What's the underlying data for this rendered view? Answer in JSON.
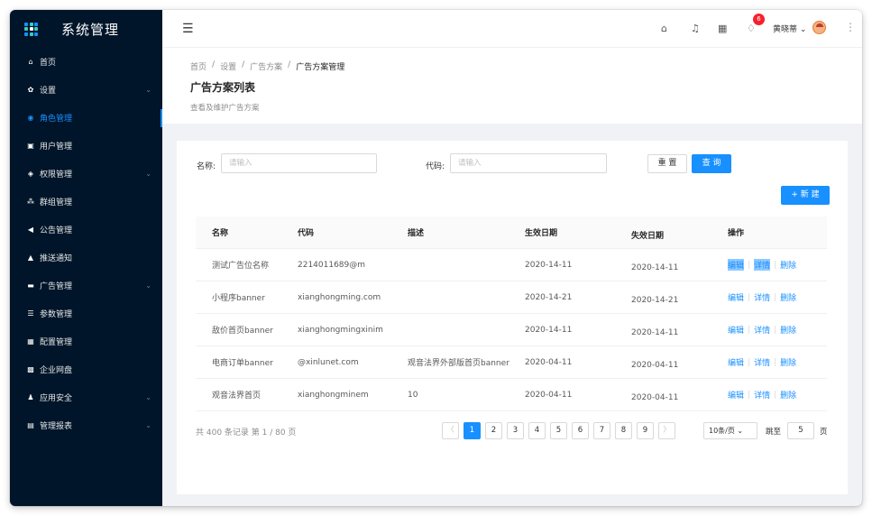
{
  "app": {
    "title": "系统管理"
  },
  "sidebar": {
    "items": [
      {
        "label": "首页",
        "icon": "home-icon",
        "glyph": "⌂",
        "expandable": false
      },
      {
        "label": "设置",
        "icon": "settings-icon",
        "glyph": "✿",
        "expandable": true
      },
      {
        "label": "角色管理",
        "icon": "role-icon",
        "glyph": "◉",
        "expandable": false,
        "active": true
      },
      {
        "label": "用户管理",
        "icon": "user-icon",
        "glyph": "▣",
        "expandable": false
      },
      {
        "label": "权限管理",
        "icon": "shield-icon",
        "glyph": "◈",
        "expandable": true
      },
      {
        "label": "群组管理",
        "icon": "group-icon",
        "glyph": "⁂",
        "expandable": false
      },
      {
        "label": "公告管理",
        "icon": "speaker-icon",
        "glyph": "◀",
        "expandable": false
      },
      {
        "label": "推送通知",
        "icon": "bell-icon",
        "glyph": "▲",
        "expandable": false
      },
      {
        "label": "广告管理",
        "icon": "ad-icon",
        "glyph": "▬",
        "expandable": true
      },
      {
        "label": "参数管理",
        "icon": "param-icon",
        "glyph": "☰",
        "expandable": false
      },
      {
        "label": "配置管理",
        "icon": "config-icon",
        "glyph": "▦",
        "expandable": false
      },
      {
        "label": "企业网盘",
        "icon": "disk-icon",
        "glyph": "▩",
        "expandable": false
      },
      {
        "label": "应用安全",
        "icon": "app-security-icon",
        "glyph": "♟",
        "expandable": true
      },
      {
        "label": "管理报表",
        "icon": "report-icon",
        "glyph": "▤",
        "expandable": true
      }
    ]
  },
  "header": {
    "notification_count": "6",
    "username": "黄晓蒂 ⌄"
  },
  "breadcrumb": {
    "items": [
      "首页",
      "/",
      "设置",
      "/",
      "广告方案",
      "/"
    ],
    "current": "广告方案管理"
  },
  "page": {
    "title": "广告方案列表",
    "subtitle": "查看及维护广告方案"
  },
  "filters": {
    "name_label": "名称:",
    "name_placeholder": "请输入",
    "code_label": "代码:",
    "code_placeholder": "请输入",
    "reset_label": "重 置",
    "query_label": "查 询",
    "new_label": "+ 新 建"
  },
  "table": {
    "headers": [
      "名称",
      "代码",
      "描述",
      "生效日期",
      "失效日期",
      "操作"
    ],
    "rows": [
      {
        "name": "测试广告位名称",
        "code": "2214011689@m",
        "desc": "",
        "start": "2020-14-11",
        "end": "2020-14-11"
      },
      {
        "name": "小程序banner",
        "code": "xianghongming.com",
        "desc": "",
        "start": "2020-14-21",
        "end": "2020-14-21"
      },
      {
        "name": "敌价首页banner",
        "code": "xianghongmingxinim",
        "desc": "",
        "start": "2020-14-11",
        "end": "2020-14-11"
      },
      {
        "name": "电商订单banner",
        "code": "@xinlunet.com",
        "desc": "观音法界外部版首页banner",
        "start": "2020-04-11",
        "end": "2020-04-11"
      },
      {
        "name": "观音法界首页",
        "code": "xianghongminem",
        "desc": "10",
        "start": "2020-04-11",
        "end": "2020-04-11"
      }
    ],
    "actions": {
      "edit": "编辑",
      "detail": "详情",
      "delete": "删除"
    }
  },
  "pagination": {
    "summary": "共 400 条记录 第 1 / 80 页",
    "prev": "〈",
    "next": "〉",
    "pages": [
      "1",
      "2",
      "3",
      "4",
      "5",
      "6",
      "7",
      "8",
      "9"
    ],
    "current_page": "1",
    "page_size": "10条/页 ⌄",
    "jump_label": "跳至",
    "jump_value": "5",
    "jump_suffix": "页"
  },
  "colors": {
    "sidebar_bg": "#001529",
    "primary": "#1890ff",
    "badge": "#f5222d"
  }
}
